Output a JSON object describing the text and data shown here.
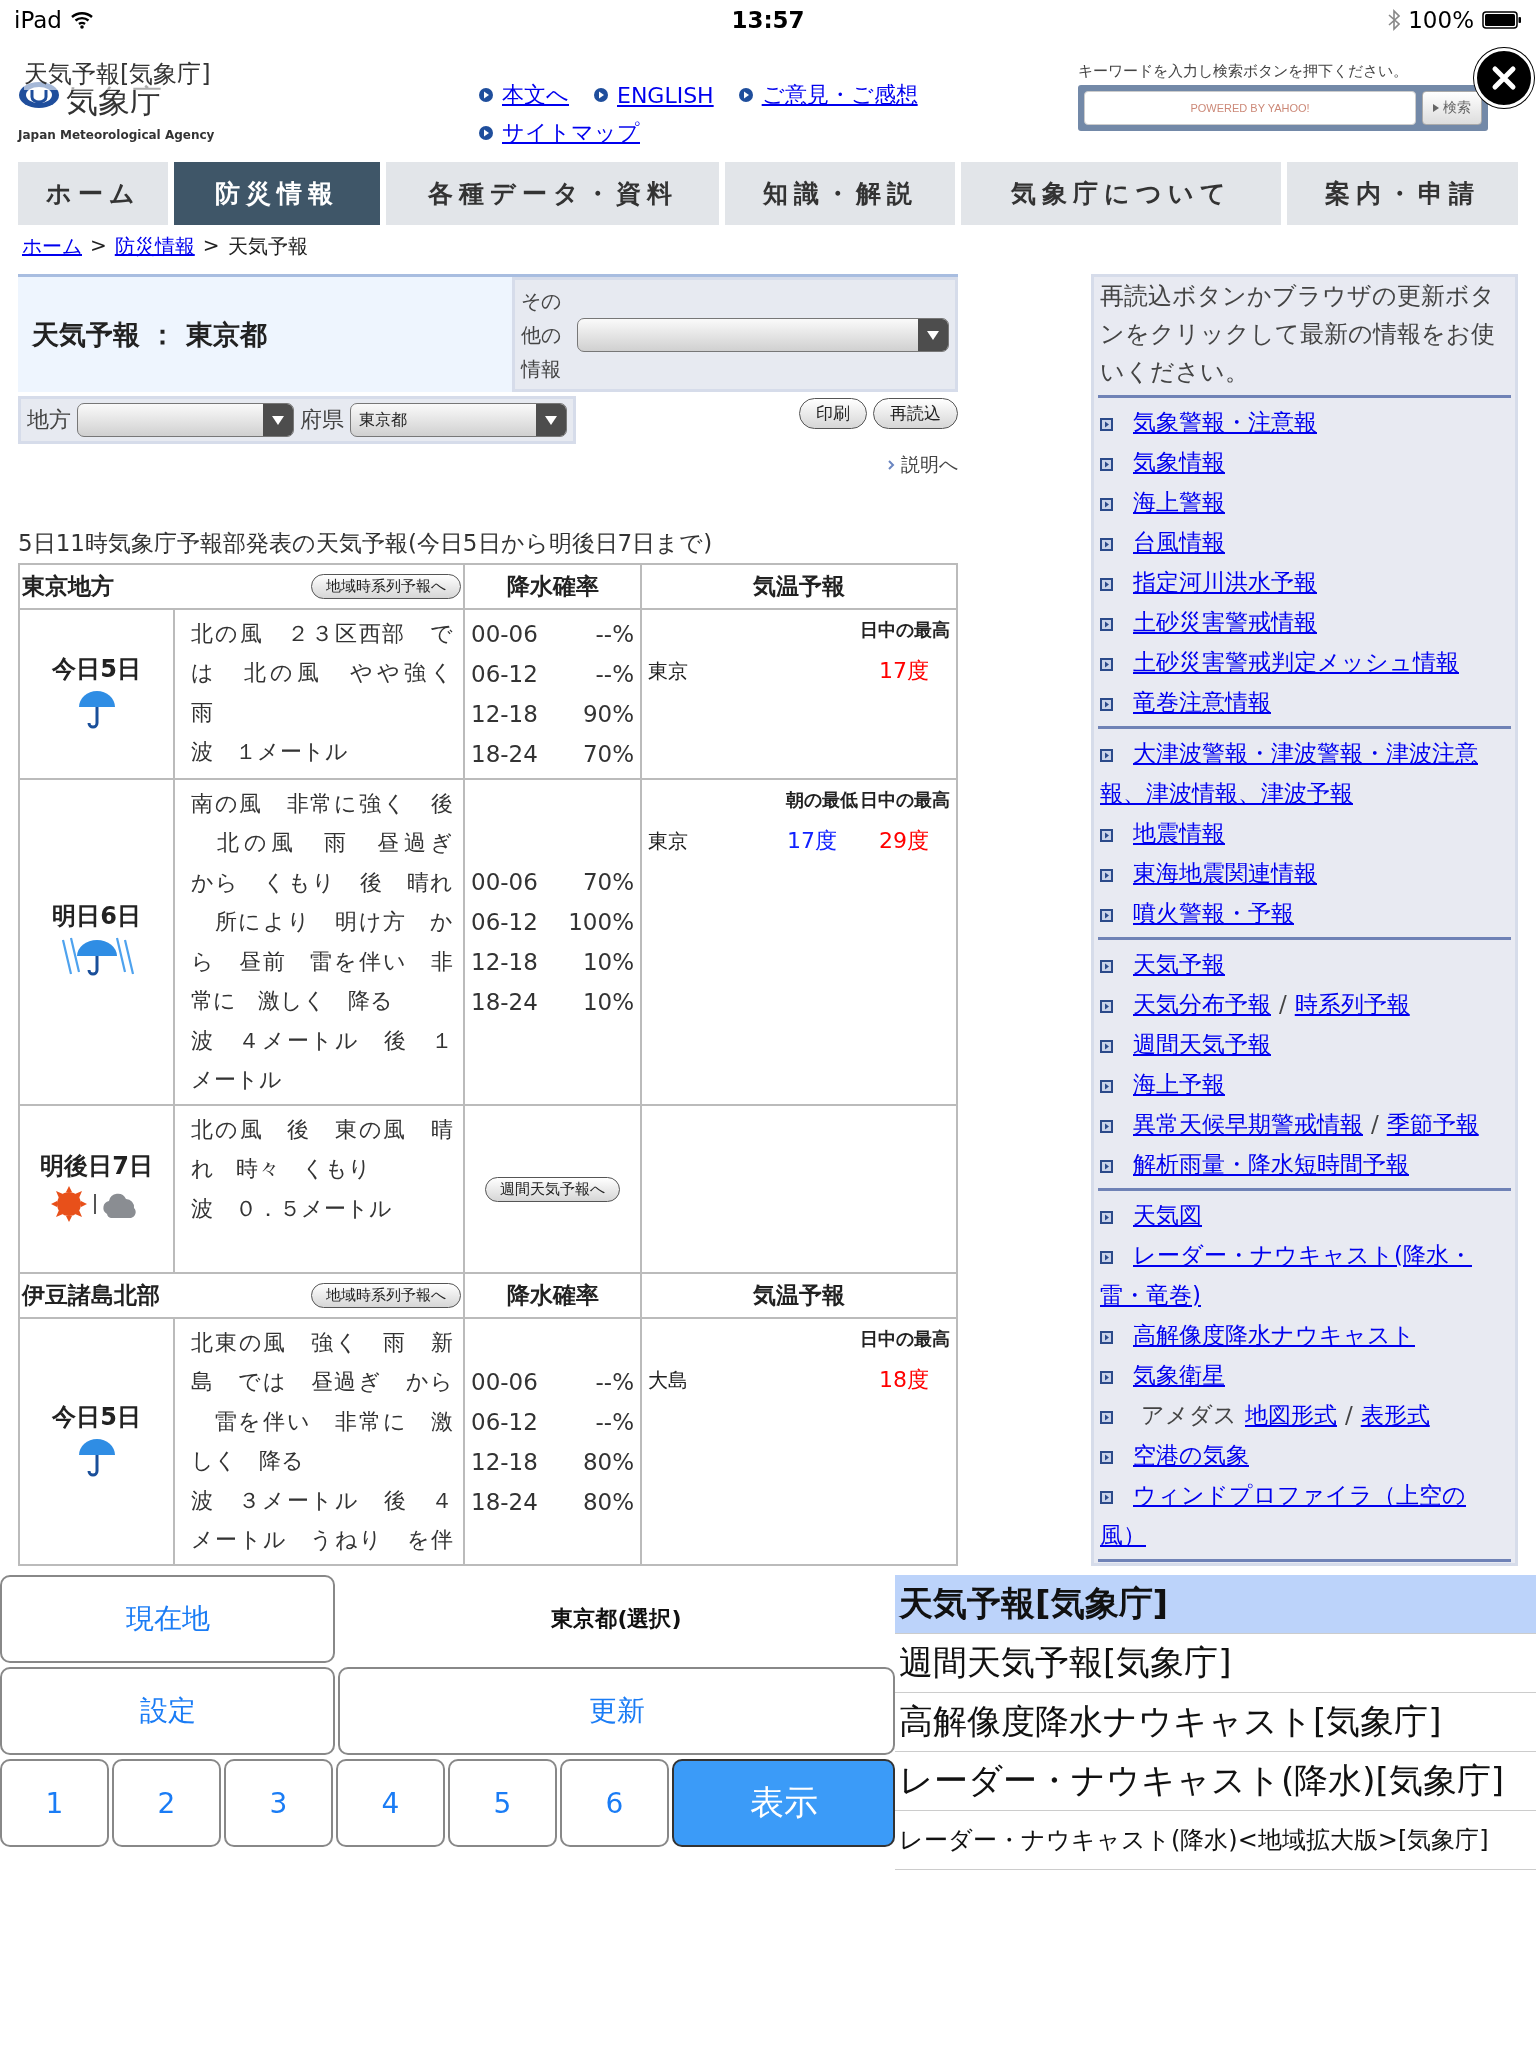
{
  "status_bar": {
    "device": "iPad",
    "time": "13:57",
    "battery": "100%"
  },
  "header": {
    "page_title": "天気予報[気象庁]",
    "logo_text": "気象庁",
    "logo_subtitle": "Japan Meteorological Agency",
    "links": [
      "本文へ",
      "ENGLISH",
      "ご意見・ご感想",
      "サイトマップ"
    ],
    "search": {
      "hint": "キーワードを入力し検索ボタンを押下ください。",
      "placeholder": "POWERED BY YAHOO!",
      "button": "検索"
    }
  },
  "nav": [
    {
      "label": "ホーム",
      "selected": false
    },
    {
      "label": "防災情報",
      "selected": true
    },
    {
      "label": "各種データ・資料",
      "selected": false
    },
    {
      "label": "知識・解説",
      "selected": false
    },
    {
      "label": "気象庁について",
      "selected": false
    },
    {
      "label": "案内・申請",
      "selected": false
    }
  ],
  "breadcrumb": [
    {
      "text": "ホーム",
      "link": true
    },
    {
      "text": ">",
      "link": false
    },
    {
      "text": "防災情報",
      "link": true
    },
    {
      "text": ">",
      "link": false
    },
    {
      "text": "天気予報",
      "link": false
    }
  ],
  "title_box": {
    "title": "天気予報 ： 東京都",
    "other_label": "その他の情報"
  },
  "selectors": [
    {
      "label": "地方"
    },
    {
      "label": "府県",
      "value": "東京都"
    }
  ],
  "actions": [
    "印刷",
    "再読込"
  ],
  "help_link": "説明へ",
  "forecast_heading": "5日11時気象庁予報部発表の天気予報(今日5日から明後日7日まで)",
  "regions": [
    {
      "name": "東京地方",
      "series_button": "地域時系列予報へ",
      "rain_header": "降水確率",
      "temp_header": "気温予報",
      "days": [
        {
          "label": "今日5日",
          "kind": "rain",
          "text": [
            "北の風　２３区西部　で",
            "は　北の風　やや強く",
            "雨",
            "波　１メートル"
          ],
          "rain": [
            {
              "time": "00-06",
              "value": "--%"
            },
            {
              "time": "06-12",
              "value": "--%"
            },
            {
              "time": "12-18",
              "value": "90%"
            },
            {
              "time": "18-24",
              "value": "70%"
            }
          ],
          "temp": {
            "headers": [
              "日中の最高"
            ],
            "rows": [
              {
                "place": "東京",
                "values": [
                  {
                    "text": "17度",
                    "kind": "max"
                  }
                ]
              }
            ]
          }
        },
        {
          "label": "明日6日",
          "kind": "heavy_rain",
          "text": [
            "南の風　非常に強く　後",
            "　北の風　雨　昼過ぎ",
            "から　くもり　後　晴れ",
            "　所により　明け方　か",
            "ら　昼前　雷を伴い　非",
            "常に　激しく　降る",
            "波　４メートル　後　１",
            "メートル"
          ],
          "rain": [
            {
              "time": "00-06",
              "value": "70%"
            },
            {
              "time": "06-12",
              "value": "100%"
            },
            {
              "time": "12-18",
              "value": "10%"
            },
            {
              "time": "18-24",
              "value": "10%"
            }
          ],
          "temp": {
            "headers": [
              "朝の最低",
              "日中の最高"
            ],
            "rows": [
              {
                "place": "東京",
                "values": [
                  {
                    "text": "17度",
                    "kind": "min"
                  },
                  {
                    "text": "29度",
                    "kind": "max"
                  }
                ]
              }
            ]
          }
        },
        {
          "label": "明後日7日",
          "kind": "sun_cloud",
          "text": [
            "北の風　後　東の風　晴",
            "れ　時々　くもり",
            "波　０．５メートル"
          ],
          "rain_button": "週間天気予報へ"
        }
      ]
    },
    {
      "name": "伊豆諸島北部",
      "series_button": "地域時系列予報へ",
      "rain_header": "降水確率",
      "temp_header": "気温予報",
      "days": [
        {
          "label": "今日5日",
          "kind": "rain",
          "text": [
            "北東の風　強く　雨　新",
            "島　では　昼過ぎ　から",
            "　雷を伴い　非常に　激",
            "しく　降る",
            "波　３メートル　後　４",
            "メートル　うねり　を伴"
          ],
          "rain": [
            {
              "time": "00-06",
              "value": "--%"
            },
            {
              "time": "06-12",
              "value": "--%"
            },
            {
              "time": "12-18",
              "value": "80%"
            },
            {
              "time": "18-24",
              "value": "80%"
            }
          ],
          "temp": {
            "headers": [
              "日中の最高"
            ],
            "rows": [
              {
                "place": "大島",
                "values": [
                  {
                    "text": "18度",
                    "kind": "max"
                  }
                ]
              }
            ]
          }
        }
      ]
    }
  ],
  "sidebar": {
    "notice": "再読込ボタンかブラウザの更新ボタンをクリックして最新の情報をお使いください。",
    "groups": [
      [
        {
          "parts": [
            {
              "text": "気象警報・注意報",
              "link": true
            }
          ]
        },
        {
          "parts": [
            {
              "text": "気象情報",
              "link": true
            }
          ]
        },
        {
          "parts": [
            {
              "text": "海上警報",
              "link": true
            }
          ]
        },
        {
          "parts": [
            {
              "text": "台風情報",
              "link": true
            }
          ]
        },
        {
          "parts": [
            {
              "text": "指定河川洪水予報",
              "link": true
            }
          ]
        },
        {
          "parts": [
            {
              "text": "土砂災害警戒情報",
              "link": true
            }
          ]
        },
        {
          "parts": [
            {
              "text": "土砂災害警戒判定メッシュ情報",
              "link": true
            }
          ]
        },
        {
          "parts": [
            {
              "text": "竜巻注意情報",
              "link": true
            }
          ]
        }
      ],
      [
        {
          "parts": [
            {
              "text": "大津波警報・津波警報・津波注意報、津波情報、津波予報",
              "link": true
            }
          ]
        },
        {
          "parts": [
            {
              "text": "地震情報",
              "link": true
            }
          ]
        },
        {
          "parts": [
            {
              "text": "東海地震関連情報",
              "link": true
            }
          ]
        },
        {
          "parts": [
            {
              "text": "噴火警報・予報",
              "link": true
            }
          ]
        }
      ],
      [
        {
          "parts": [
            {
              "text": "天気予報",
              "link": true
            }
          ]
        },
        {
          "parts": [
            {
              "text": "天気分布予報",
              "link": true
            },
            {
              "text": "/",
              "link": false
            },
            {
              "text": "時系列予報",
              "link": true
            }
          ]
        },
        {
          "parts": [
            {
              "text": "週間天気予報",
              "link": true
            }
          ]
        },
        {
          "parts": [
            {
              "text": "海上予報",
              "link": true
            }
          ]
        },
        {
          "parts": [
            {
              "text": "異常天候早期警戒情報",
              "link": true
            },
            {
              "text": "/",
              "link": false
            },
            {
              "text": "季節予報",
              "link": true
            }
          ]
        },
        {
          "parts": [
            {
              "text": "解析雨量・降水短時間予報",
              "link": true
            }
          ]
        }
      ],
      [
        {
          "parts": [
            {
              "text": "天気図",
              "link": true
            }
          ]
        },
        {
          "parts": [
            {
              "text": "レーダー・ナウキャスト(降水・雷・竜巻)",
              "link": true
            }
          ]
        },
        {
          "parts": [
            {
              "text": "高解像度降水ナウキャスト",
              "link": true
            }
          ]
        },
        {
          "parts": [
            {
              "text": "気象衛星",
              "link": true
            }
          ]
        },
        {
          "parts": [
            {
              "text": "アメダス",
              "link": false
            },
            {
              "text": "地図形式",
              "link": true
            },
            {
              "text": "/",
              "link": false
            },
            {
              "text": "表形式",
              "link": true
            }
          ]
        },
        {
          "parts": [
            {
              "text": "空港の気象",
              "link": true
            }
          ]
        },
        {
          "parts": [
            {
              "text": "ウィンドプロファイラ（上空の風）",
              "link": true
            }
          ]
        }
      ]
    ]
  },
  "bottom": {
    "location_button": "現在地",
    "selection": "東京都(選択)",
    "settings_button": "設定",
    "refresh_button": "更新",
    "number_buttons": [
      "1",
      "2",
      "3",
      "4",
      "5",
      "6"
    ],
    "show_button": "表示",
    "list": [
      {
        "text": "天気予報[気象庁]",
        "selected": true
      },
      {
        "text": "週間天気予報[気象庁]",
        "selected": false
      },
      {
        "text": "高解像度降水ナウキャスト[気象庁]",
        "selected": false
      },
      {
        "text": "レーダー・ナウキャスト(降水)[気象庁]",
        "selected": false
      },
      {
        "text": "レーダー・ナウキャスト(降水)<地域拡大版>[気象庁]",
        "selected": false
      }
    ]
  }
}
